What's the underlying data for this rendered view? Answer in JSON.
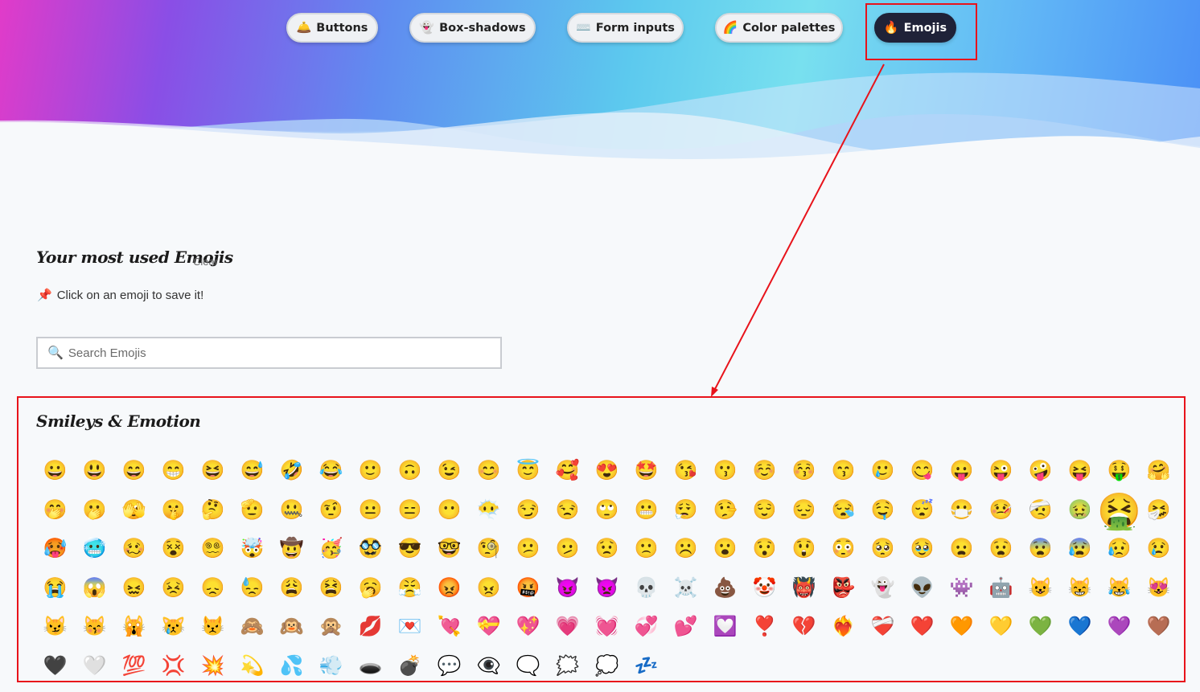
{
  "nav": [
    {
      "icon": "🛎️",
      "label": "Buttons",
      "active": false
    },
    {
      "icon": "👻",
      "label": "Box-shadows",
      "active": false
    },
    {
      "icon": "⌨️",
      "label": "Form inputs",
      "active": false
    },
    {
      "icon": "🌈",
      "label": "Color palettes",
      "active": false
    },
    {
      "icon": "🔥",
      "label": "Emojis",
      "active": true
    }
  ],
  "most_used": {
    "title": "Your most used Emojis",
    "clear_label": "Clear",
    "hint_icon": "📌",
    "hint_text": "Click on an emoji to save it!"
  },
  "search": {
    "icon": "🔍",
    "placeholder": "Search Emojis"
  },
  "section": {
    "title": "Smileys & Emotion",
    "emojis": [
      "😀",
      "😃",
      "😄",
      "😁",
      "😆",
      "😅",
      "🤣",
      "😂",
      "🙂",
      "🙃",
      "😉",
      "😊",
      "😇",
      "🥰",
      "😍",
      "🤩",
      "😘",
      "😗",
      "☺️",
      "😚",
      "😙",
      "🥲",
      "😋",
      "😛",
      "😜",
      "🤪",
      "😝",
      "🤑",
      "🤗",
      "🤭",
      "🫢",
      "🫣",
      "🤫",
      "🤔",
      "🫡",
      "🤐",
      "🤨",
      "😐",
      "😑",
      "😶",
      "😶‍🌫️",
      "😏",
      "😒",
      "🙄",
      "😬",
      "😮‍💨",
      "🤥",
      "😌",
      "😔",
      "😪",
      "🤤",
      "😴",
      "😷",
      "🤒",
      "🤕",
      "🤢",
      "🤮",
      "🤧",
      "🥵",
      "🥶",
      "🥴",
      "😵",
      "😵‍💫",
      "🤯",
      "🤠",
      "🥳",
      "🥸",
      "😎",
      "🤓",
      "🧐",
      "😕",
      "🫤",
      "😟",
      "🙁",
      "☹️",
      "😮",
      "😯",
      "😲",
      "😳",
      "🥺",
      "🥹",
      "😦",
      "😧",
      "😨",
      "😰",
      "😥",
      "😢",
      "😭",
      "😱",
      "😖",
      "😣",
      "😞",
      "😓",
      "😩",
      "😫",
      "🥱",
      "😤",
      "😡",
      "😠",
      "🤬",
      "😈",
      "👿",
      "💀",
      "☠️",
      "💩",
      "🤡",
      "👹",
      "👺",
      "👻",
      "👽",
      "👾",
      "🤖",
      "😺",
      "😸",
      "😹",
      "😻",
      "😼",
      "😽",
      "🙀",
      "😿",
      "😾",
      "🙈",
      "🙉",
      "🙊",
      "💋",
      "💌",
      "💘",
      "💝",
      "💖",
      "💗",
      "💓",
      "💞",
      "💕",
      "💟",
      "❣️",
      "💔",
      "❤️‍🔥",
      "❤️‍🩹",
      "❤️",
      "🧡",
      "💛",
      "💚",
      "💙",
      "💜",
      "🤎",
      "🖤",
      "🤍",
      "💯",
      "💢",
      "💥",
      "💫",
      "💦",
      "💨",
      "🕳️",
      "💣",
      "💬",
      "👁️‍🗨️",
      "🗨️",
      "🗯️",
      "💭",
      "💤"
    ]
  }
}
